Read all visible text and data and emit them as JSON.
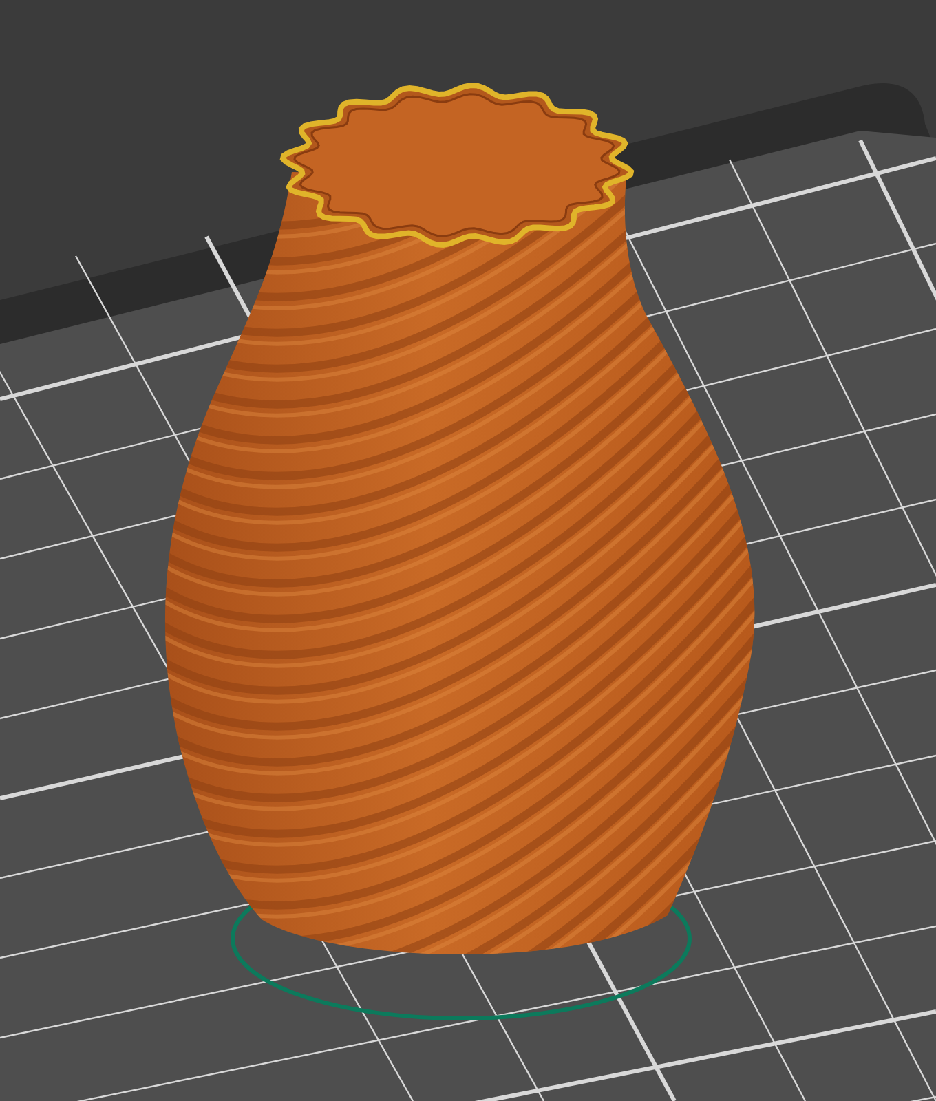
{
  "viewport": {
    "objects": [
      {
        "kind": "bed"
      },
      {
        "kind": "skirt"
      },
      {
        "kind": "vase"
      }
    ]
  }
}
